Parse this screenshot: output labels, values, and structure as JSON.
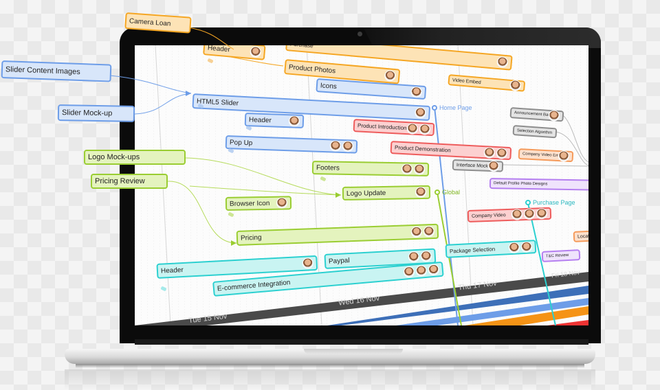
{
  "scene": "Laptop mockup showing a Gantt-style project timeline with task boxes, milestones and dependency links",
  "colors": {
    "orange": "#f5a623",
    "blue": "#6d9de8",
    "red": "#ee5c5c",
    "green": "#9acd32",
    "cyan": "#2bd0d0",
    "gray": "#8d8d8d",
    "purple": "#b57ff0",
    "peach": "#f59a5a"
  },
  "external_tasks": [
    {
      "label": "Camera Loan",
      "color": "orange"
    },
    {
      "label": "Slider Content Images",
      "color": "blue"
    },
    {
      "label": "Slider Mock-up",
      "color": "blue"
    },
    {
      "label": "Logo Mock-ups",
      "color": "green"
    },
    {
      "label": "Pricing Review",
      "color": "green"
    }
  ],
  "tasks": [
    {
      "label": "Header",
      "color": "orange",
      "avatars": 1
    },
    {
      "label": "Purchase",
      "color": "orange",
      "avatars": 1
    },
    {
      "label": "Product Photos",
      "color": "orange",
      "avatars": 1
    },
    {
      "label": "Video Embed",
      "color": "orange",
      "avatars": 1
    },
    {
      "label": "Icons",
      "color": "blue",
      "avatars": 1
    },
    {
      "label": "HTML5 Slider",
      "color": "blue",
      "avatars": 1
    },
    {
      "label": "Header",
      "color": "blue",
      "avatars": 1
    },
    {
      "label": "Pop Up",
      "color": "blue",
      "avatars": 2
    },
    {
      "label": "Product Introduction",
      "color": "red",
      "avatars": 2
    },
    {
      "label": "Product Demonstration",
      "color": "red",
      "avatars": 2
    },
    {
      "label": "Footers",
      "color": "green",
      "avatars": 2
    },
    {
      "label": "Logo Update",
      "color": "green",
      "avatars": 1
    },
    {
      "label": "Browser Icon",
      "color": "green",
      "avatars": 1
    },
    {
      "label": "Pricing",
      "color": "green",
      "avatars": 2
    },
    {
      "label": "Header",
      "color": "cyan",
      "avatars": 1
    },
    {
      "label": "Paypal",
      "color": "cyan",
      "avatars": 2
    },
    {
      "label": "E-commerce Integration",
      "color": "cyan",
      "avatars": 3
    },
    {
      "label": "Package Selection",
      "color": "cyan",
      "avatars": 2
    },
    {
      "label": "Announcement Banner",
      "color": "gray",
      "avatars": 1
    },
    {
      "label": "Selection Algorithm",
      "color": "gray",
      "avatars": 0
    },
    {
      "label": "Interface Mock-up",
      "color": "gray",
      "avatars": 1
    },
    {
      "label": "Company Video Embed",
      "color": "peach",
      "avatars": 1
    },
    {
      "label": "Default Profile Photo Designs",
      "color": "purple",
      "avatars": 0
    },
    {
      "label": "Company Video",
      "color": "red",
      "avatars": 3
    },
    {
      "label": "T&C Review",
      "color": "purple",
      "avatars": 0
    },
    {
      "label": "Location",
      "color": "peach",
      "avatars": 0
    }
  ],
  "milestones": [
    {
      "label": "Home Page",
      "color": "blue"
    },
    {
      "label": "Global",
      "color": "green"
    },
    {
      "label": "Purchase Page",
      "color": "cyan"
    }
  ],
  "timeline": {
    "dates": [
      "Tue 15 Nov",
      "Wed 16 Nov",
      "Thu 17 Nov",
      "Fri 18 Nov"
    ]
  }
}
